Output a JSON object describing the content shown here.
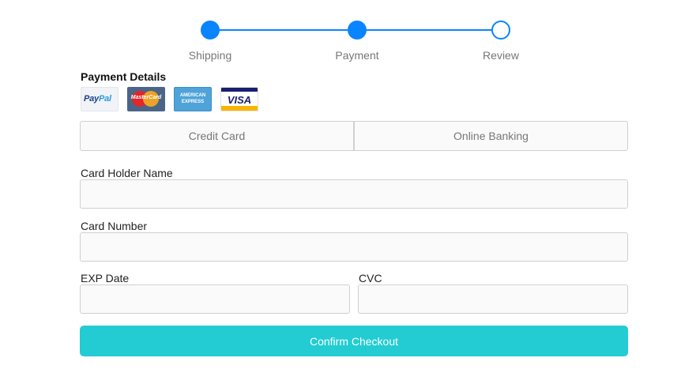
{
  "colors": {
    "accent": "#0a84ff",
    "confirm_button": "#22ccd2"
  },
  "stepper": {
    "current_step": 2,
    "steps": [
      {
        "label": "Shipping",
        "state": "completed"
      },
      {
        "label": "Payment",
        "state": "current"
      },
      {
        "label": "Review",
        "state": "pending"
      }
    ]
  },
  "payment": {
    "title": "Payment Details",
    "card_logos": [
      {
        "name": "paypal-logo",
        "text_a": "Pay",
        "text_b": "Pal"
      },
      {
        "name": "mastercard-logo",
        "text": "MasterCard"
      },
      {
        "name": "amex-logo",
        "line1": "AMERICAN",
        "line2": "EXPRESS"
      },
      {
        "name": "visa-logo",
        "text": "VISA"
      }
    ],
    "tabs": [
      {
        "label": "Credit Card"
      },
      {
        "label": "Online Banking"
      }
    ]
  },
  "form": {
    "card_holder": {
      "label": "Card Holder Name",
      "value": "",
      "placeholder": ""
    },
    "card_number": {
      "label": "Card Number",
      "value": "",
      "placeholder": ""
    },
    "exp_date": {
      "label": "EXP Date",
      "value": "",
      "placeholder": ""
    },
    "cvc": {
      "label": "CVC",
      "value": "",
      "placeholder": ""
    },
    "confirm_label": "Confirm Checkout"
  }
}
